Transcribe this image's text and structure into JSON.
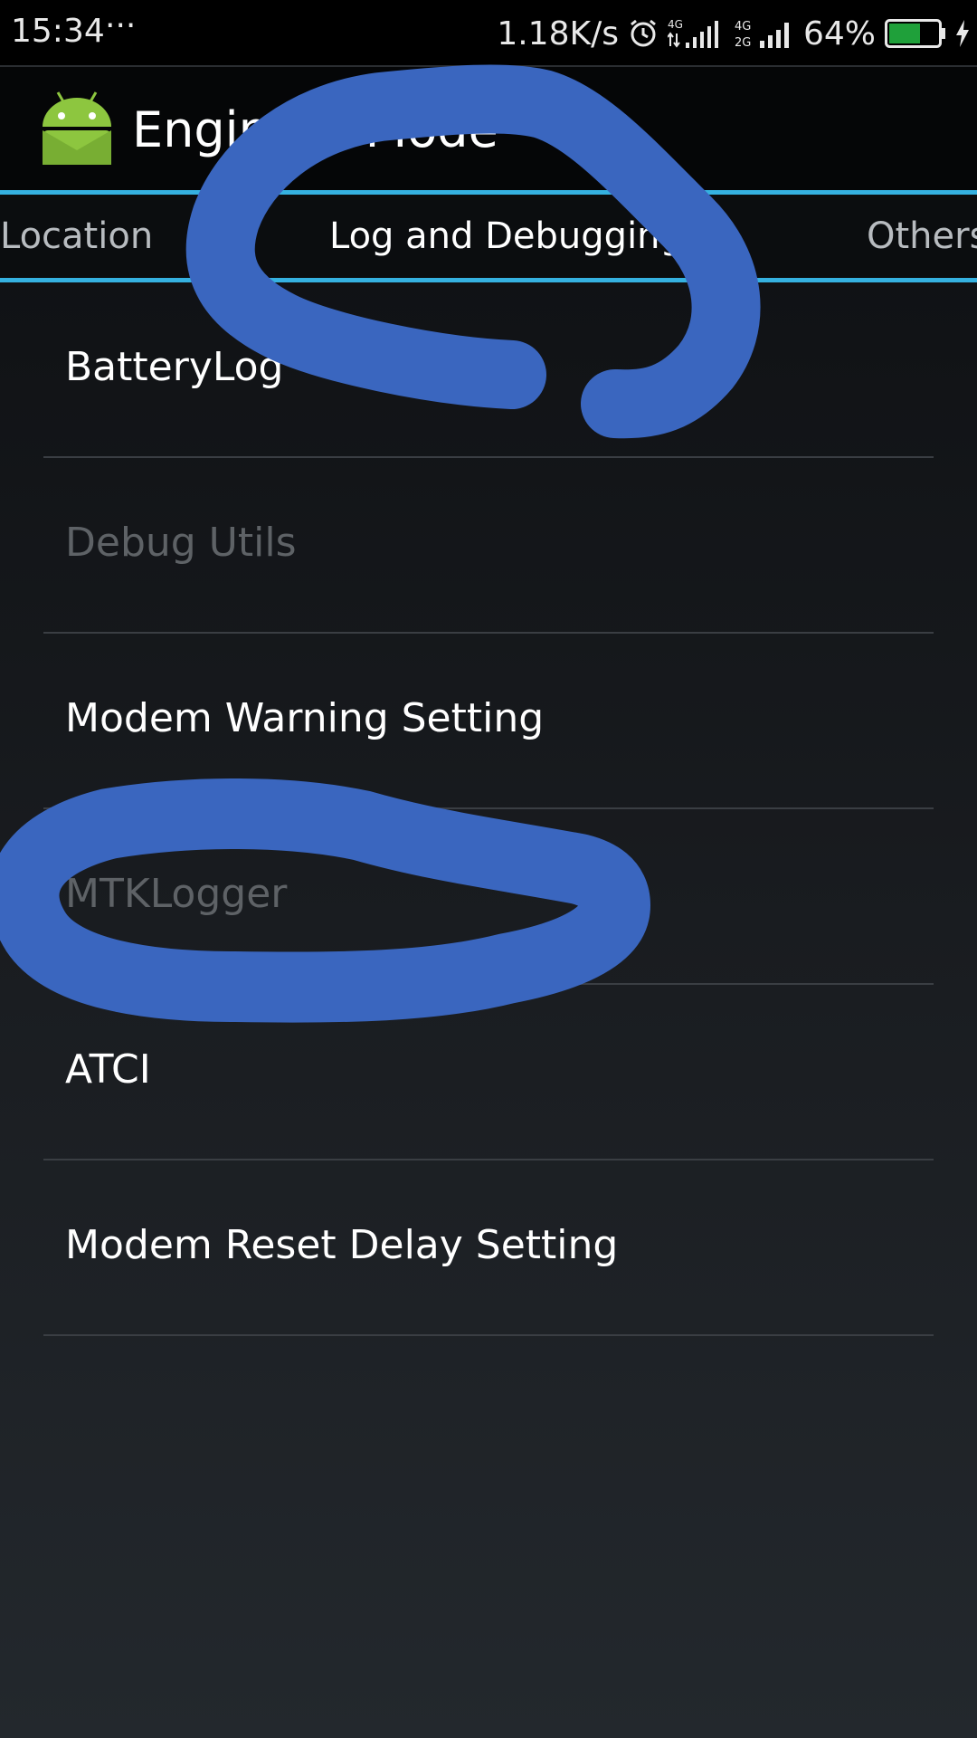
{
  "status_bar": {
    "time": "15:34",
    "dots": "···",
    "net_speed": "1.18K/s",
    "battery": "64%",
    "icons": [
      "alarm-icon",
      "signal-4g-icon",
      "signal-4g-2g-icon",
      "signal-bars-icon",
      "battery-icon",
      "charging-bolt-icon"
    ],
    "net_labels": [
      "4G",
      "4G",
      "2G"
    ],
    "battery_color": "#1fa03a"
  },
  "action_bar": {
    "title": "Engineer Mode",
    "icon": "android-icon",
    "icon_color": "#8dc63f"
  },
  "tabs": [
    {
      "label": "Location",
      "selected": false
    },
    {
      "label": "Log and Debugging",
      "selected": true
    },
    {
      "label": "Others",
      "selected": false
    }
  ],
  "tab_accent": "#35b1e0",
  "list": [
    {
      "label": "BatteryLog",
      "enabled": true
    },
    {
      "label": "Debug Utils",
      "enabled": false
    },
    {
      "label": "Modem Warning Setting",
      "enabled": true
    },
    {
      "label": "MTKLogger",
      "enabled": false
    },
    {
      "label": "ATCI",
      "enabled": true
    },
    {
      "label": "Modem Reset Delay Setting",
      "enabled": true
    }
  ],
  "annotation_color": "#3a66bf"
}
